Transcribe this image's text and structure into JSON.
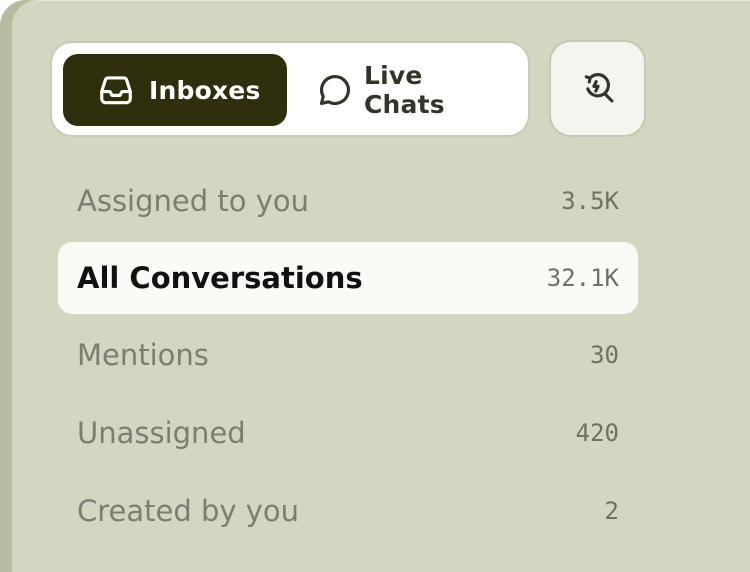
{
  "tabs": {
    "inboxes_label": "Inboxes",
    "live_chats_label": "Live Chats",
    "active": "Inboxes"
  },
  "toolbar": {
    "search_icon": "search-history-icon"
  },
  "inbox_list": [
    {
      "label": "Assigned to you",
      "count": "3.5K",
      "selected": false
    },
    {
      "label": "All Conversations",
      "count": "32.1K",
      "selected": true
    },
    {
      "label": "Mentions",
      "count": "30",
      "selected": false
    },
    {
      "label": "Unassigned",
      "count": "420",
      "selected": false
    },
    {
      "label": "Created by you",
      "count": "2",
      "selected": false
    }
  ],
  "colors": {
    "panel_background": "#d3d6c1",
    "active_tab_background": "#2f2f0e",
    "selected_row_background": "#fafaf6"
  }
}
